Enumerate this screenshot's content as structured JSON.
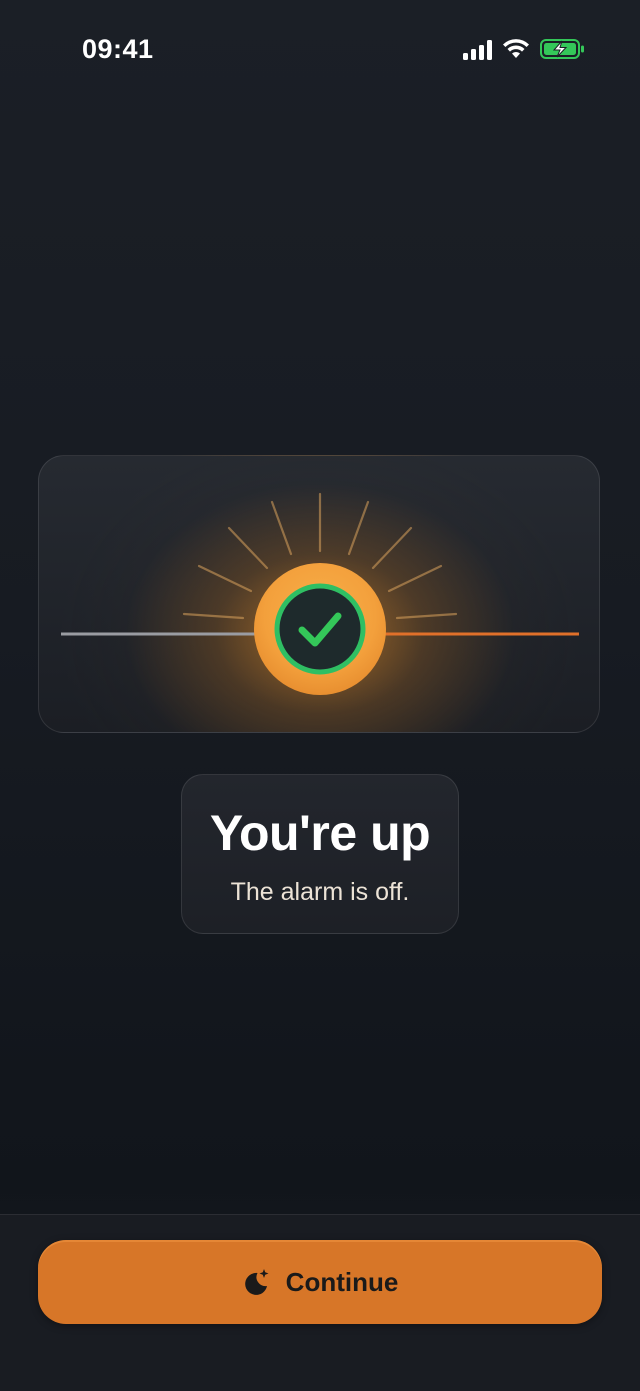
{
  "status_bar": {
    "time": "09:41",
    "icons": [
      "signal-icon",
      "wifi-icon",
      "battery-charging-icon"
    ],
    "battery_color": "#34c759"
  },
  "hero": {
    "icon": "check-icon",
    "sun_color": "#f5a340",
    "check_color": "#34c759",
    "horizon_left_color": "#9a9ca2",
    "horizon_right_color": "#e0702a"
  },
  "message": {
    "title": "You're up",
    "subtitle": "The alarm is off."
  },
  "footer": {
    "continue_label": "Continue",
    "continue_icon": "moon-sparkle-icon",
    "accent": "#d77628"
  }
}
